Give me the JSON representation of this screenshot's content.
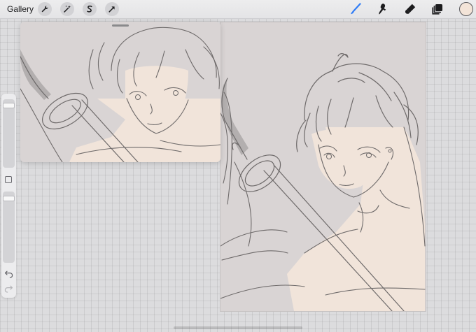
{
  "topbar": {
    "gallery_label": "Gallery",
    "left_tools": [
      "wrench-icon",
      "magic-wand-icon",
      "selection-icon",
      "transform-arrow-icon"
    ],
    "right_tools": [
      "brush-icon",
      "smudge-icon",
      "eraser-icon",
      "layers-icon"
    ],
    "active_tool": "brush-icon",
    "active_color": "#f3e4d8",
    "accent_color": "#2f7cf6"
  },
  "sidebar": {
    "brush_size_level": 0.05,
    "brush_opacity_level": 0.06
  },
  "artwork": {
    "skin_color": "#f1e4da",
    "background_color": "#d9d4d4",
    "line_color": "#6e6a6a"
  }
}
